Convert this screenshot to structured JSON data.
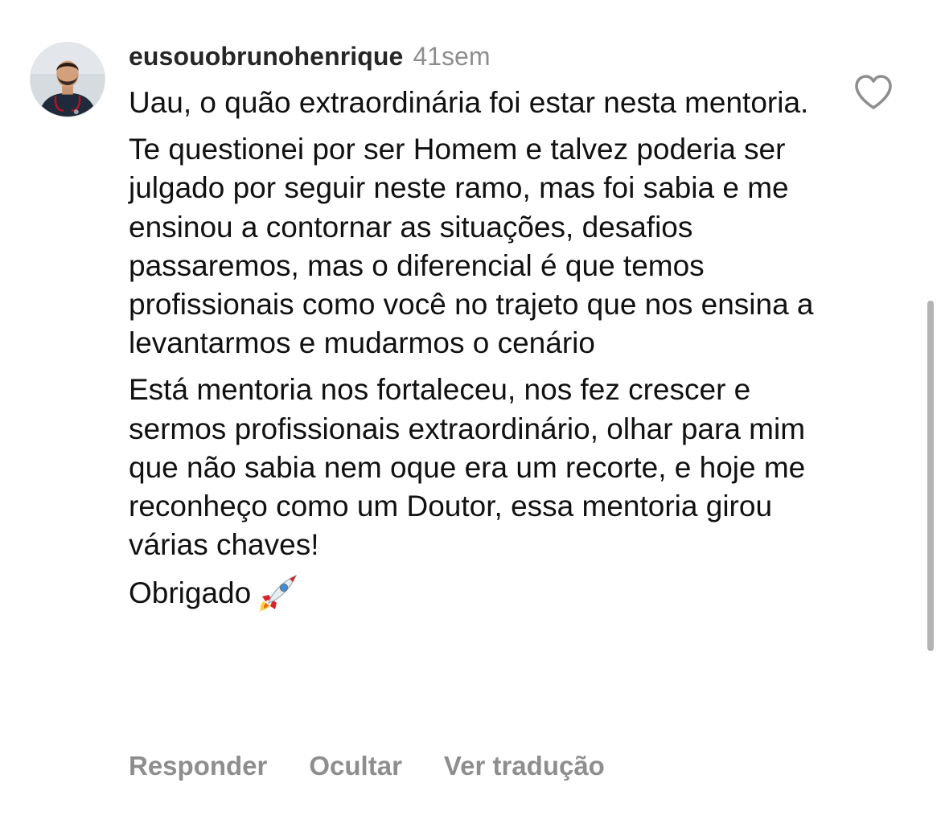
{
  "comment": {
    "username": "eusouobrunohenrique",
    "time_ago": "41sem",
    "paragraphs": [
      "Uau, o quão extraordinária foi estar nesta mentoria.",
      "Te questionei por ser Homem e talvez poderia ser julgado por seguir neste ramo, mas foi sabia e me ensinou a contornar as situações, desafios passaremos, mas o diferencial é que temos profissionais como você no trajeto que nos ensina a levantarmos e mudarmos o cenário",
      "Está mentoria nos fortaleceu, nos fez crescer e sermos profissionais extraordinário, olhar para mim que não sabia nem oque era um recorte, e hoje me reconheço como um Doutor, essa mentoria girou várias chaves!",
      "Obrigado"
    ],
    "emoji": "rocket-emoji"
  },
  "actions": {
    "reply_label": "Responder",
    "hide_label": "Ocultar",
    "translate_label": "Ver tradução"
  },
  "icons": {
    "like": "heart-outline-icon"
  },
  "colors": {
    "text": "#111111",
    "secondary": "#8e8e8e",
    "username": "#262626"
  }
}
